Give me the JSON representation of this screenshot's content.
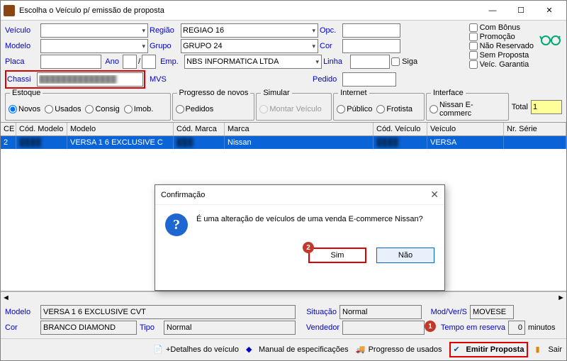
{
  "window": {
    "title": "Escolha o Veículo p/ emissão de proposta"
  },
  "form": {
    "veiculo_label": "Veículo",
    "regiao_label": "Região",
    "regiao_value": "REGIAO 16",
    "opc_label": "Opc.",
    "modelo_label": "Modelo",
    "grupo_label": "Grupo",
    "grupo_value": "GRUPO 24",
    "cor_label": "Cor",
    "placa_label": "Placa",
    "ano_label": "Ano",
    "ano_sep": "/",
    "emp_label": "Emp.",
    "emp_value": "NBS INFORMATICA LTDA",
    "linha_label": "Linha",
    "siga_label": "Siga",
    "chassi_label": "Chassi",
    "chassi_value": "██████████████",
    "mvs_label": "MVS",
    "pedido_label": "Pedido"
  },
  "checks": {
    "com_bonus": "Com Bônus",
    "promocao": "Promoção",
    "nao_reservado": "Não Reservado",
    "sem_proposta": "Sem Proposta",
    "veic_garantia": "Veíc. Garantia"
  },
  "groups": {
    "estoque": {
      "title": "Estoque",
      "novos": "Novos",
      "usados": "Usados",
      "consig": "Consig",
      "imob": "Imob."
    },
    "progresso": {
      "title": "Progresso de novos",
      "pedidos": "Pedidos"
    },
    "simular": {
      "title": "Simular",
      "montar": "Montar Veículo"
    },
    "internet": {
      "title": "Internet",
      "publico": "Público",
      "frotista": "Frotista"
    },
    "interface": {
      "title": "Interface",
      "nissan": "Nissan E-commerc"
    },
    "total_label": "Total",
    "total_value": "1"
  },
  "grid": {
    "headers": {
      "ce": "CE",
      "cod_modelo": "Cód. Modelo",
      "modelo": "Modelo",
      "cod_marca": "Cód. Marca",
      "marca": "Marca",
      "cod_veiculo": "Cód. Veículo",
      "veiculo": "Veículo",
      "nr_serie": "Nr. Série"
    },
    "row": {
      "ce": "2",
      "cod_modelo": "████",
      "modelo": "VERSA 1 6 EXCLUSIVE C",
      "cod_marca": "███",
      "marca": "Nissan",
      "cod_veiculo": "████",
      "veiculo": "VERSA",
      "nr_serie": ""
    }
  },
  "bottom": {
    "modelo_label": "Modelo",
    "modelo_value": "VERSA 1 6 EXCLUSIVE CVT",
    "situacao_label": "Situação",
    "situacao_value": "Normal",
    "modvers_label": "Mod/Ver/S",
    "modvers_value": "MOVESE",
    "cor_label": "Cor",
    "cor_value": "BRANCO DIAMOND",
    "tipo_label": "Tipo",
    "tipo_value": "Normal",
    "vendedor_label": "Vendedor",
    "tempo_label": "Tempo em reserva",
    "tempo_value": "0",
    "minutos": "minutos"
  },
  "statusbar": {
    "detalhes": "+Detalhes do veículo",
    "manual": "Manual de especificações",
    "progresso": "Progresso de usados",
    "emitir": "Emitir Proposta",
    "sair": "Sair"
  },
  "dialog": {
    "title": "Confirmação",
    "message": "É uma alteração de veículos de uma venda E-commerce Nissan?",
    "sim": "Sim",
    "nao": "Não"
  }
}
